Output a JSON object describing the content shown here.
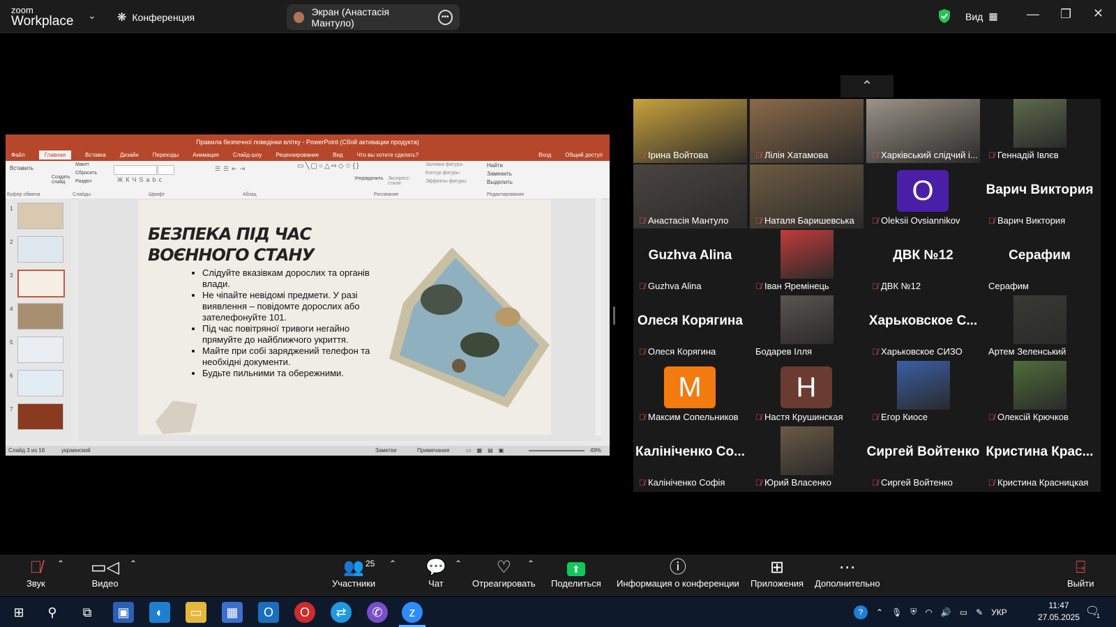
{
  "app": {
    "logo_top": "zoom",
    "logo_bottom": "Workplace"
  },
  "topbar": {
    "conference_label": "Конференция",
    "screen_share_label": "Экран (Анастасія Мантуло)",
    "view_label": "Вид",
    "security_color": "#23c552"
  },
  "ppt": {
    "window_title": "Правила безпечної поведінки влітку - PowerPoint (Сбой активации продукта)",
    "tabs": [
      "Файл",
      "Главная",
      "Вставка",
      "Дизайн",
      "Переходы",
      "Анимация",
      "Слайд-шоу",
      "Рецензирование",
      "Вид",
      "Что вы хотите сделать?"
    ],
    "right_links": [
      "Вход",
      "Общий доступ"
    ],
    "ribbon_groups": [
      "Буфер обмена",
      "Слайды",
      "Шрифт",
      "Абзац",
      "Рисование",
      "Редактирование"
    ],
    "ribbon_labels": [
      "Вставить",
      "Создать слайд",
      "Макет",
      "Сбросить",
      "Раздел",
      "Упорядочить",
      "Экспресс-стили",
      "Заливка фигуры",
      "Контур фигуры",
      "Эффекты фигуры",
      "Найти",
      "Заменить",
      "Выделить"
    ],
    "thumb_numbers": [
      "1",
      "2",
      "3",
      "4",
      "5",
      "6",
      "7"
    ],
    "slide_title": "БЕЗПЕКА ПІД ЧАС ВОЄННОГО СТАНУ",
    "bullets": [
      "Слідуйте вказівкам дорослих та органів влади.",
      "Не чіпайте невідомі предмети. У разі виявлення – повідомте дорослих або зателефонуйте 101.",
      "Під час повітряної тривоги негайно прямуйте до найближчого укриття.",
      "Майте при собі заряджений телефон та необхідні документи.",
      "Будьте пильними та обережними."
    ],
    "status_left": "Слайд 3 из 16",
    "status_lang": "украинский",
    "status_notes": "Заметки",
    "status_comments": "Примечания",
    "zoom": "49%"
  },
  "participants": [
    {
      "name": "Ірина Войтова",
      "type": "video",
      "bg": "#c9a23c"
    },
    {
      "name": "Лілія Хатамова",
      "type": "video",
      "bg": "#8a6a4a"
    },
    {
      "name": "Харківський слідчий і...",
      "type": "video",
      "bg": "#9a9488"
    },
    {
      "name": "Геннадій Івлєв",
      "type": "photo",
      "bg": "#5e6a4d"
    },
    {
      "name": "Анастасія Мантуло",
      "type": "video",
      "bg": "#4a4440",
      "active": true
    },
    {
      "name": "Наталя Баришевська",
      "type": "video",
      "bg": "#6d5b42"
    },
    {
      "name": "Oleksii Ovsiannikov",
      "type": "avatar",
      "letter": "O",
      "bg": "#4a1fa8"
    },
    {
      "name": "Варич Виктория",
      "type": "text",
      "big": "Варич Виктория"
    },
    {
      "name": "Guzhva Alina",
      "type": "text",
      "big": "Guzhva Alina"
    },
    {
      "name": "Іван Яремінець",
      "type": "photo",
      "bg": "#c23b3b"
    },
    {
      "name": "ДВК №12",
      "type": "text",
      "big": "ДВК №12"
    },
    {
      "name": "Серафим",
      "type": "text",
      "big": "Серафим",
      "nomute": true
    },
    {
      "name": "Олеся Корягина",
      "type": "text",
      "big": "Олеся Корягина"
    },
    {
      "name": "Бодарев Ілля",
      "type": "photo",
      "bg": "#5a5550",
      "nomute": true
    },
    {
      "name": "Харьковское СИЗО",
      "type": "text",
      "big": "Харьковское С..."
    },
    {
      "name": "Артем Зеленський",
      "type": "photo",
      "bg": "#3a3a34",
      "nomute": true
    },
    {
      "name": "Максим Сопельников",
      "type": "avatar",
      "letter": "M",
      "bg": "#f27a0f"
    },
    {
      "name": "Настя Крушинская",
      "type": "avatar",
      "letter": "Н",
      "bg": "#6b3b31"
    },
    {
      "name": "Егор Киосе",
      "type": "photo",
      "bg": "#3a5fa6"
    },
    {
      "name": "Олексій Крючков",
      "type": "photo",
      "bg": "#4f6d3a"
    },
    {
      "name": "Калініченко Софія",
      "type": "text",
      "big": "Калініченко Со..."
    },
    {
      "name": "Юрий Власенко",
      "type": "photo",
      "bg": "#6a5a46"
    },
    {
      "name": "Сиргей Войтенко",
      "type": "text",
      "big": "Сиргей Войтенко"
    },
    {
      "name": "Кристина Красницкая",
      "type": "text",
      "big": "Кристина Крас..."
    }
  ],
  "toolbar": {
    "audio": "Звук",
    "video": "Видео",
    "participants": "Участники",
    "participants_count": "25",
    "chat": "Чат",
    "react": "Отреагировать",
    "share": "Поделиться",
    "info": "Информация о конференции",
    "apps": "Приложения",
    "more": "Дополнительно",
    "leave": "Выйти",
    "share_color": "#0ecb59"
  },
  "taskbar": {
    "lang": "УКР",
    "time": "11:47",
    "date": "27.05.2025",
    "notifications": "1"
  }
}
